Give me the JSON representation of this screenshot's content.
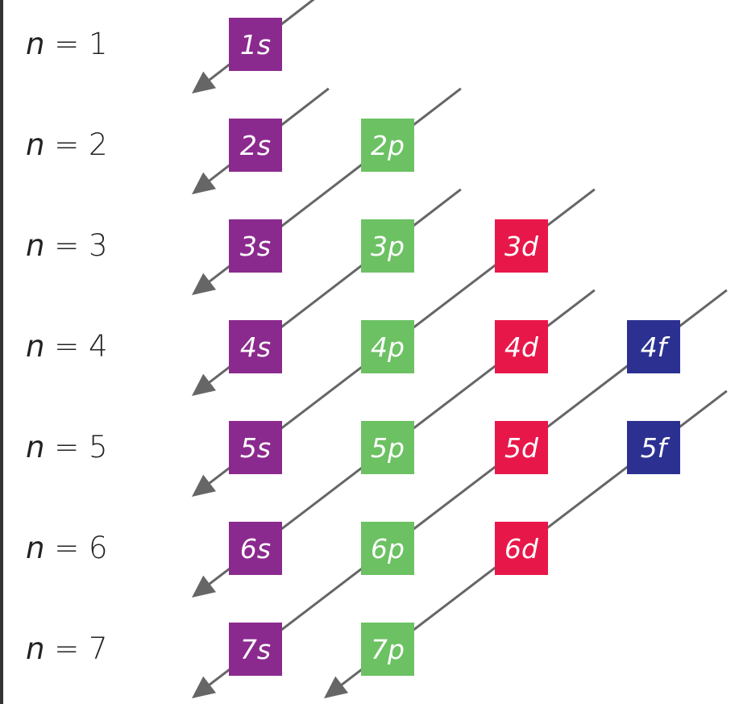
{
  "rows": [
    {
      "var": "n",
      "eq": " = 1",
      "orbitals": [
        "1s"
      ]
    },
    {
      "var": "n",
      "eq": " = 2",
      "orbitals": [
        "2s",
        "2p"
      ]
    },
    {
      "var": "n",
      "eq": " = 3",
      "orbitals": [
        "3s",
        "3p",
        "3d"
      ]
    },
    {
      "var": "n",
      "eq": " = 4",
      "orbitals": [
        "4s",
        "4p",
        "4d",
        "4f"
      ]
    },
    {
      "var": "n",
      "eq": " = 5",
      "orbitals": [
        "5s",
        "5p",
        "5d",
        "5f"
      ]
    },
    {
      "var": "n",
      "eq": " = 6",
      "orbitals": [
        "6s",
        "6p",
        "6d"
      ]
    },
    {
      "var": "n",
      "eq": " = 7",
      "orbitals": [
        "7s",
        "7p"
      ]
    }
  ],
  "colors": {
    "s": "#8b2a8e",
    "p": "#6cc163",
    "d": "#e8174a",
    "f": "#2c3191",
    "arrow": "#666666",
    "edge": "#333333"
  }
}
